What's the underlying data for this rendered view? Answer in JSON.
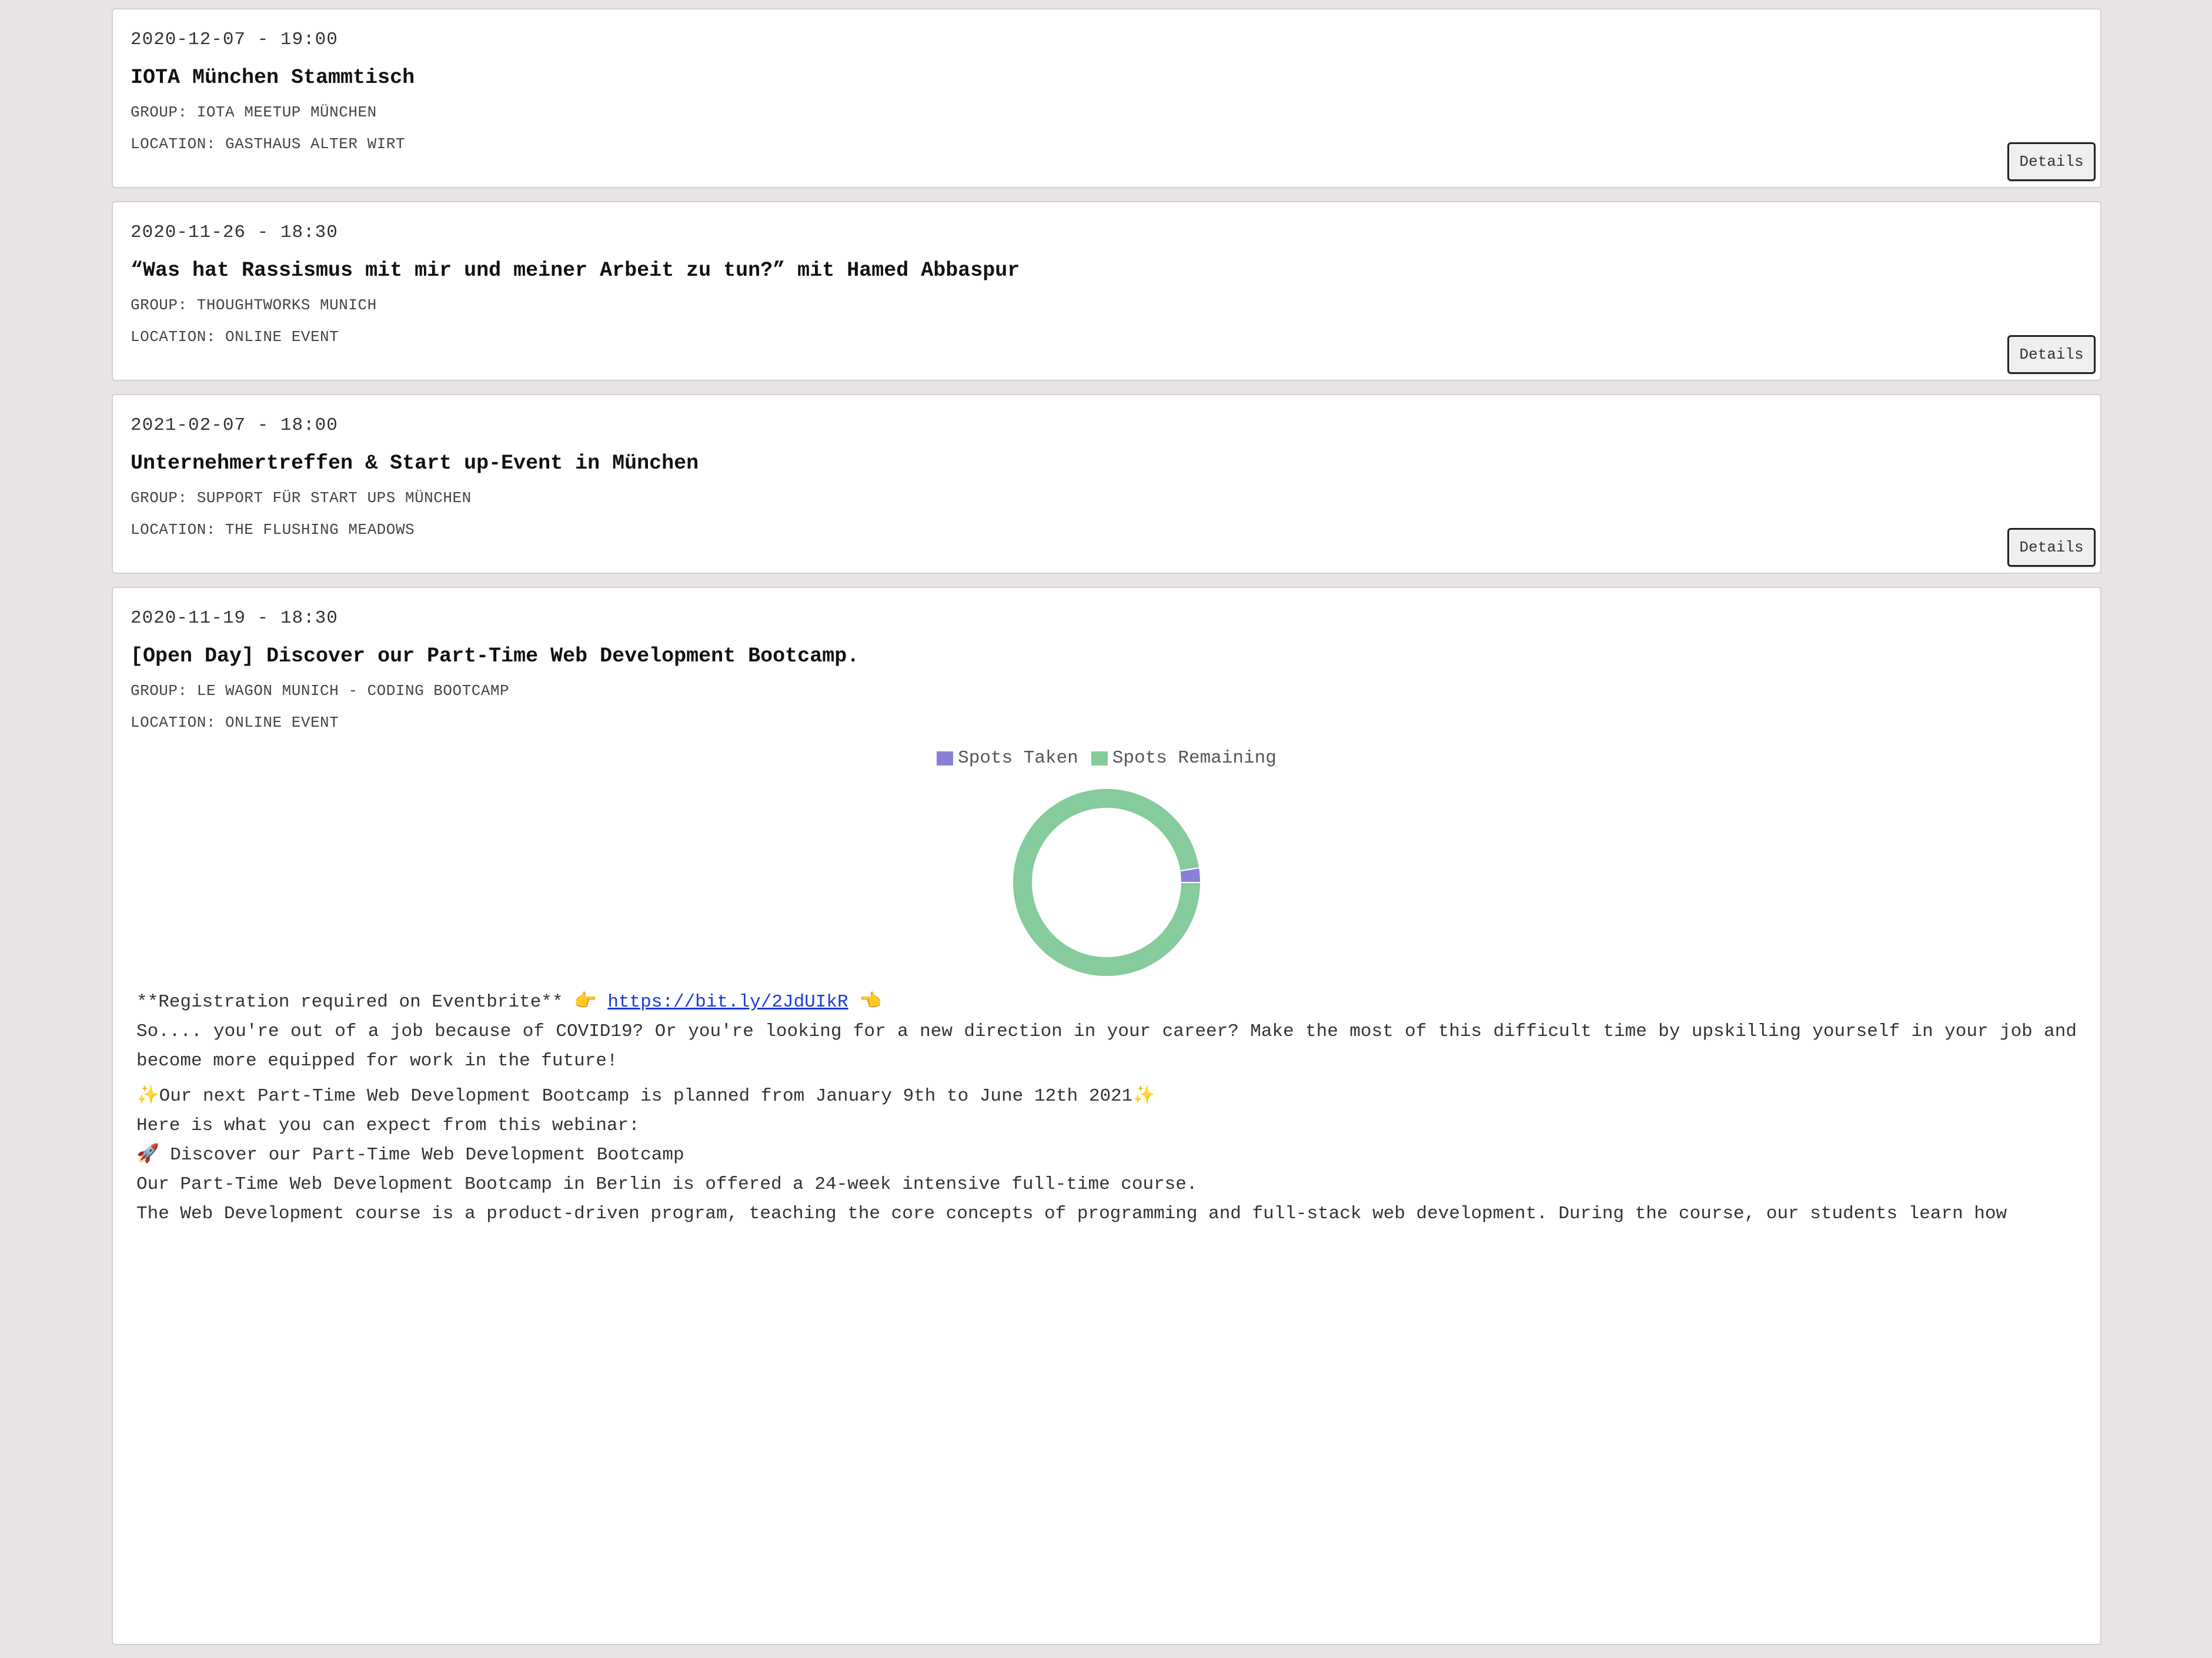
{
  "events": [
    {
      "date": "2020-12-07 - 19:00",
      "title": "IOTA München Stammtisch",
      "group": "GROUP: IOTA MEETUP MÜNCHEN",
      "location": "LOCATION: GASTHAUS ALTER WIRT",
      "button": "Details"
    },
    {
      "date": "2020-11-26 - 18:30",
      "title": "“Was hat Rassismus mit mir und meiner Arbeit zu tun?” mit Hamed Abbaspur",
      "group": "GROUP: THOUGHTWORKS MUNICH",
      "location": "LOCATION: ONLINE EVENT",
      "button": "Details"
    },
    {
      "date": "2021-02-07 - 18:00",
      "title": "Unternehmertreffen & Start up-Event in München",
      "group": "GROUP: SUPPORT FÜR START UPS MÜNCHEN",
      "location": "LOCATION: THE FLUSHING MEADOWS",
      "button": "Details"
    },
    {
      "date": "2020-11-19 - 18:30",
      "title": "[Open Day] Discover our Part-Time Web Development Bootcamp.",
      "group": "GROUP: LE WAGON MUNICH - CODING BOOTCAMP",
      "location": "LOCATION: ONLINE EVENT",
      "description": {
        "reg_prefix": "**Registration required on Eventbrite** 👉 ",
        "reg_link": "https://bit.ly/2JdUIkR",
        "reg_suffix": " 👈",
        "p1": "So.... you're out of a job because of COVID19? Or you're looking for a new direction in your career? Make the most of this difficult time by upskilling yourself in your job and become more equipped for work in the future!",
        "p2": "✨Our next Part-Time Web Development Bootcamp is planned from January 9th to June 12th 2021✨",
        "p3": "Here is what you can expect from this webinar:",
        "p4": "🚀 Discover our Part-Time Web Development Bootcamp",
        "p5": "Our Part-Time Web Development Bootcamp in Berlin is offered a 24-week intensive full-time course.",
        "p6": "The Web Development course is a product-driven program, teaching the core concepts of programming and full-stack web development. During the course, our students learn how"
      }
    }
  ],
  "chart_data": {
    "type": "pie",
    "categories": [
      "Spots Taken",
      "Spots Remaining"
    ],
    "values": [
      1,
      39
    ],
    "colors": [
      "#8a7fd8",
      "#85cb9b"
    ],
    "legend": "top"
  }
}
